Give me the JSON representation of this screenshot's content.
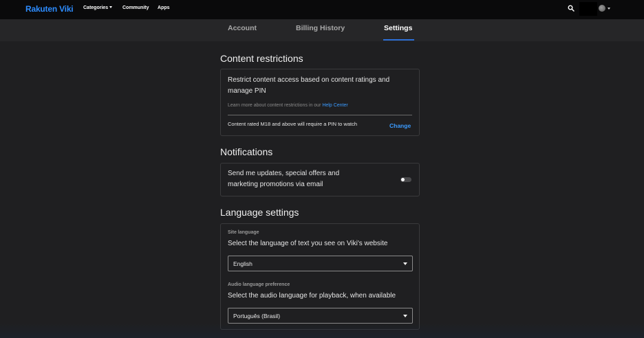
{
  "topnav": {
    "logo_part1": "Rakuten",
    "logo_part2": "Viki",
    "items": [
      "Categories",
      "Community",
      "Apps"
    ]
  },
  "tabs": [
    "Account",
    "Billing History",
    "Settings"
  ],
  "content_restrictions": {
    "title": "Content restrictions",
    "description_line1": "Restrict content access based on content ratings and",
    "description_line2": "manage PIN",
    "learn_more": "Learn more about content restrictions in our",
    "help_center": "Help Center",
    "status": "Content rated M18 and above will require a PIN to watch",
    "change": "Change"
  },
  "notifications": {
    "title": "Notifications",
    "line1": "Send me updates, special offers and",
    "line2": "marketing promotions via email",
    "enabled": false
  },
  "language": {
    "title": "Language settings",
    "site_label": "Site language",
    "site_description": "Select the language of text you see on Viki's website",
    "site_value": "English",
    "audio_label": "Audio language preference",
    "audio_description": "Select the audio language for playback, when available",
    "audio_value": "Português (Brasil)"
  },
  "colors": {
    "accent": "#2d8cff",
    "link": "#3b9bff",
    "background": "#1f1f21",
    "nav": "#0a0a0b"
  },
  "icons": [
    "search-icon",
    "avatar",
    "chevron-down-icon"
  ]
}
